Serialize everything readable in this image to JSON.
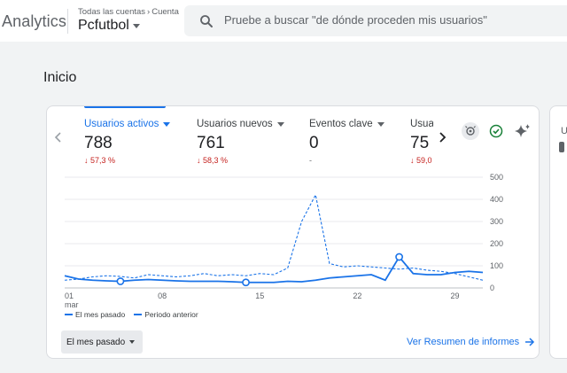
{
  "header": {
    "app_title": "Analytics",
    "breadcrumb": [
      "Todas las cuentas",
      "Cuenta"
    ],
    "property": "Pcfutbol",
    "search_placeholder": "Pruebe a buscar \"de dónde proceden mis usuarios\""
  },
  "page": {
    "title": "Inicio"
  },
  "metrics": [
    {
      "label": "Usuarios activos",
      "value": "788",
      "change": "57,3 %",
      "direction": "down"
    },
    {
      "label": "Usuarios nuevos",
      "value": "761",
      "change": "58,3 %",
      "direction": "down"
    },
    {
      "label": "Eventos clave",
      "value": "0",
      "change": "-",
      "direction": "none"
    },
    {
      "label": "Usuari",
      "value": "75",
      "change": "59,0",
      "direction": "down"
    }
  ],
  "legend": {
    "current": "El mes pasado",
    "previous": "Periodo anterior"
  },
  "range_selector": "El mes pasado",
  "report_link": "Ver Resumen de informes",
  "colors": {
    "accent": "#1a73e8",
    "negative": "#c5221f",
    "check": "#188038"
  },
  "icons": [
    "chevron-left-icon",
    "chevron-right-icon",
    "insights-icon",
    "check-circle-icon",
    "sparkle-icon",
    "search-icon",
    "arrow-right-icon"
  ],
  "chart_data": {
    "type": "line",
    "x_tick_labels": [
      "01\nmar",
      "08",
      "15",
      "22",
      "29"
    ],
    "y_ticks": [
      0,
      100,
      200,
      300,
      400,
      500
    ],
    "ylim": [
      0,
      500
    ],
    "x": [
      1,
      2,
      3,
      4,
      5,
      6,
      7,
      8,
      9,
      10,
      11,
      12,
      13,
      14,
      15,
      16,
      17,
      18,
      19,
      20,
      21,
      22,
      23,
      24,
      25,
      26,
      27,
      28,
      29,
      30,
      31
    ],
    "series": [
      {
        "name": "El mes pasado",
        "style": "solid",
        "values": [
          55,
          40,
          35,
          32,
          30,
          35,
          38,
          35,
          32,
          30,
          30,
          30,
          28,
          25,
          25,
          25,
          30,
          28,
          35,
          45,
          50,
          55,
          60,
          35,
          140,
          65,
          60,
          60,
          70,
          75,
          70
        ],
        "highlighted_points_x": [
          5,
          14,
          25
        ]
      },
      {
        "name": "Periodo anterior",
        "style": "dashed",
        "values": [
          35,
          40,
          50,
          55,
          52,
          45,
          60,
          55,
          50,
          55,
          65,
          55,
          60,
          55,
          65,
          60,
          90,
          300,
          420,
          110,
          95,
          100,
          95,
          90,
          85,
          90,
          80,
          75,
          65,
          50,
          35
        ]
      }
    ]
  }
}
